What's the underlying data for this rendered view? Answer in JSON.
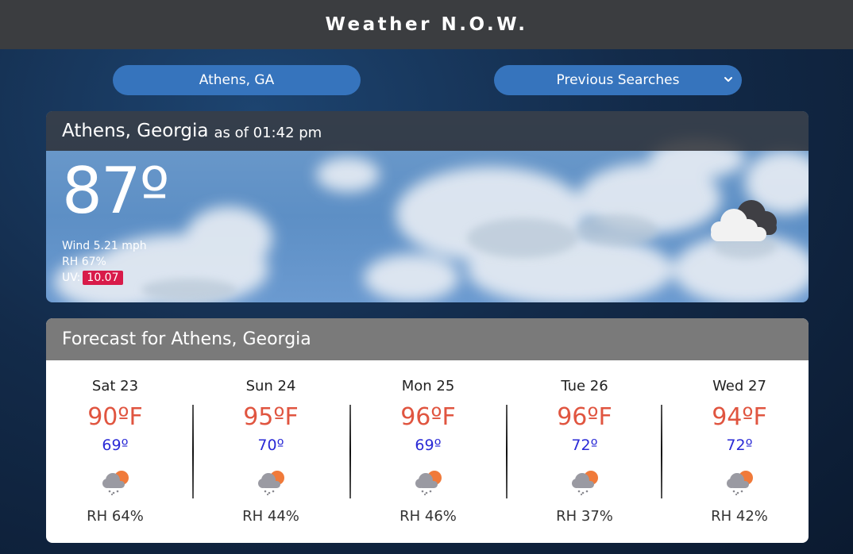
{
  "app": {
    "title": "Weather N.O.W."
  },
  "search": {
    "value": "Athens, GA"
  },
  "previous_searches": {
    "selected": "Previous Searches"
  },
  "current": {
    "city": "Athens, Georgia",
    "as_of": "as of 01:42 pm",
    "temperature": "87º",
    "wind": "Wind 5.21 mph",
    "humidity": "RH 67%",
    "uv_label": "UV:",
    "uv_value": "10.07",
    "uv_badge_color": "#d81b4a",
    "icon": "cloudy-icon"
  },
  "forecast": {
    "title": "Forecast for Athens, Georgia",
    "days": [
      {
        "day": "Sat 23",
        "high": "90ºF",
        "low": "69º",
        "icon": "rain-sun-icon",
        "rh": "RH 64%"
      },
      {
        "day": "Sun 24",
        "high": "95ºF",
        "low": "70º",
        "icon": "rain-sun-icon",
        "rh": "RH 44%"
      },
      {
        "day": "Mon 25",
        "high": "96ºF",
        "low": "69º",
        "icon": "rain-sun-icon",
        "rh": "RH 46%"
      },
      {
        "day": "Tue 26",
        "high": "96ºF",
        "low": "72º",
        "icon": "rain-sun-icon",
        "rh": "RH 37%"
      },
      {
        "day": "Wed 27",
        "high": "94ºF",
        "low": "72º",
        "icon": "rain-sun-icon",
        "rh": "RH 42%"
      }
    ]
  },
  "colors": {
    "topbar": "#3b3d40",
    "accent_blue": "#3674bd",
    "high_temp": "#e05540",
    "low_temp": "#2a2ad6"
  }
}
